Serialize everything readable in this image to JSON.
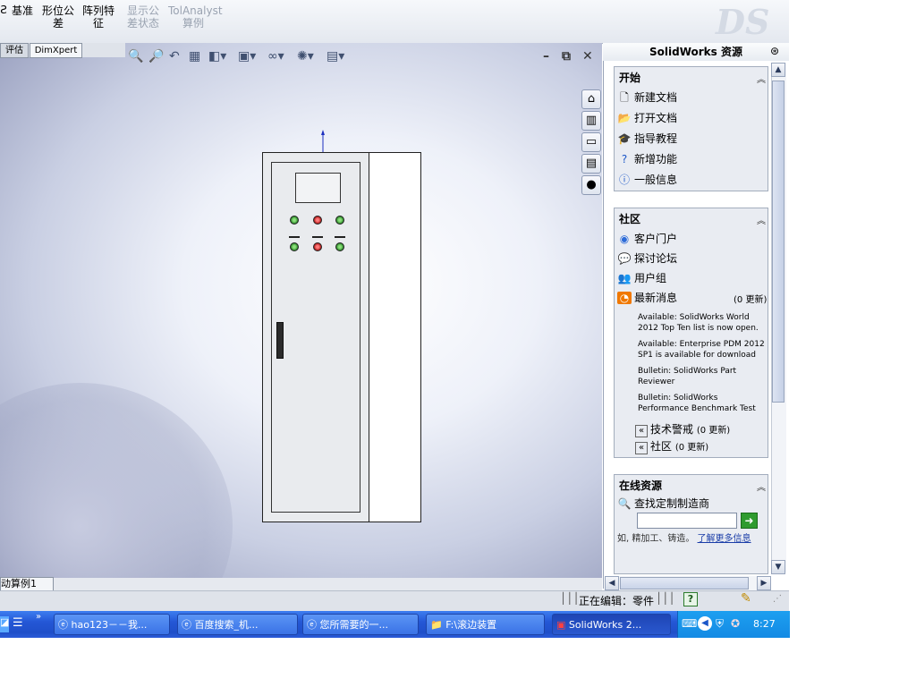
{
  "ribbon": {
    "items": [
      {
        "label": "基准"
      },
      {
        "label": "形位公\n差"
      },
      {
        "label": "阵列特\n征"
      },
      {
        "label": "显示公\n差状态"
      },
      {
        "label": "TolAnalyst\n算例"
      }
    ]
  },
  "tabs": {
    "left_fragment": "评估",
    "dimxpert": "DimXpert"
  },
  "bottom_tab": "动算例1",
  "taskpane": {
    "title": "SolidWorks 资源",
    "start": {
      "header": "开始",
      "items": [
        "新建文档",
        "打开文档",
        "指导教程",
        "新增功能",
        "一般信息"
      ]
    },
    "community": {
      "header": "社区",
      "items": [
        "客户门户",
        "探讨论坛",
        "用户组",
        "最新消息"
      ],
      "news_count": "(0 更新)",
      "news": [
        "Available: SolidWorks World 2012 Top Ten list is now open.",
        "Available: Enterprise PDM 2012 SP1 is available for download",
        "Bulletin: SolidWorks Part Reviewer",
        "Bulletin: SolidWorks Performance Benchmark Test"
      ],
      "tech_alert": "技术警戒",
      "tech_alert_count": "(0 更新)",
      "community_link": "社区",
      "community_count": "(0 更新)"
    },
    "online": {
      "header": "在线资源",
      "find_label": "查找定制制造商",
      "search_value": "",
      "hint_text": "如, 精加工、铸造。",
      "hint_link": "了解更多信息"
    }
  },
  "status": {
    "editing": "正在编辑：零件",
    "help": "?"
  },
  "taskbar": {
    "buttons": [
      {
        "label": "hao123－－我..."
      },
      {
        "label": "百度搜索_机..."
      },
      {
        "label": "您所需要的一..."
      },
      {
        "label": "F:\\滚边装置"
      },
      {
        "label": "SolidWorks 2..."
      }
    ],
    "time": "8:27"
  },
  "colors": {
    "taskbar": "#245edb",
    "accent_green_lamp": "#2c8a2a",
    "accent_red_lamp": "#b01818",
    "status_editing": "#000000"
  }
}
